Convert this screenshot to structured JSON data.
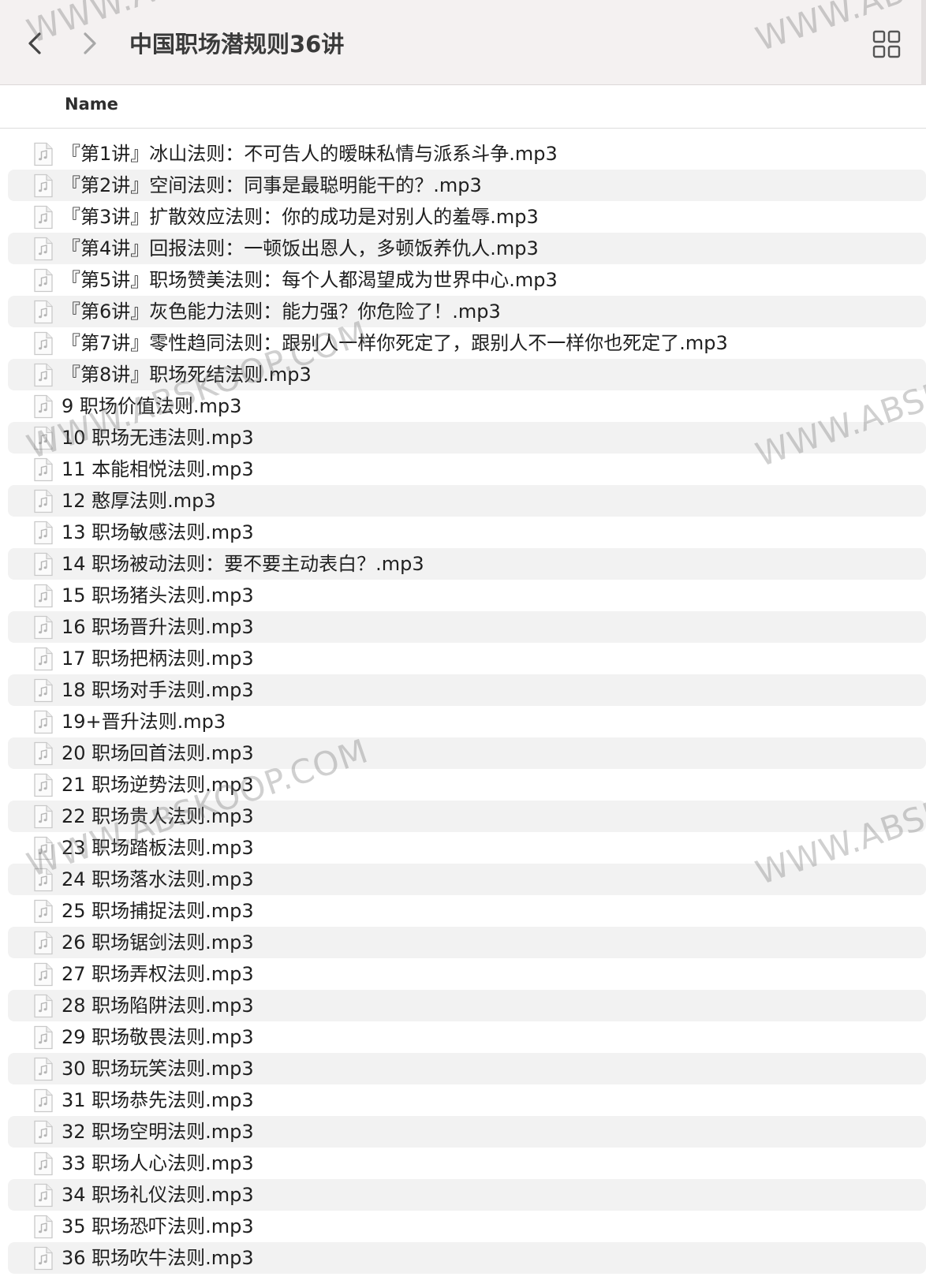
{
  "toolbar": {
    "title": "中国职场潜规则36讲",
    "back_icon": "chevron-left-icon",
    "forward_icon": "chevron-right-icon",
    "view_icon": "grid-view-icon"
  },
  "list_header": {
    "name_label": "Name"
  },
  "files": [
    "『第1讲』冰山法则：不可告人的暧昧私情与派系斗争.mp3",
    "『第2讲』空间法则：同事是最聪明能干的？.mp3",
    "『第3讲』扩散效应法则：你的成功是对别人的羞辱.mp3",
    "『第4讲』回报法则：一顿饭出恩人，多顿饭养仇人.mp3",
    "『第5讲』职场赞美法则：每个人都渴望成为世界中心.mp3",
    "『第6讲』灰色能力法则：能力强？你危险了！.mp3",
    "『第7讲』零性趋同法则：跟别人一样你死定了，跟别人不一样你也死定了.mp3",
    "『第8讲』职场死结法则.mp3",
    "9 职场价值法则.mp3",
    "10 职场无违法则.mp3",
    "11 本能相悦法则.mp3",
    "12 憨厚法则.mp3",
    "13 职场敏感法则.mp3",
    "14 职场被动法则：要不要主动表白？.mp3",
    "15 职场猪头法则.mp3",
    "16 职场晋升法则.mp3",
    "17 职场把柄法则.mp3",
    "18 职场对手法则.mp3",
    "19+晋升法则.mp3",
    "20 职场回首法则.mp3",
    "21 职场逆势法则.mp3",
    "22 职场贵人法则.mp3",
    "23 职场踏板法则.mp3",
    "24 职场落水法则.mp3",
    "25 职场捕捉法则.mp3",
    "26 职场锯剑法则.mp3",
    "27 职场弄权法则.mp3",
    "28 职场陷阱法则.mp3",
    "29 职场敬畏法则.mp3",
    "30 职场玩笑法则.mp3",
    "31 职场恭先法则.mp3",
    "32 职场空明法则.mp3",
    "33 职场人心法则.mp3",
    "34 职场礼仪法则.mp3",
    "35 职场恐吓法则.mp3",
    "36 职场吹牛法则.mp3"
  ],
  "file_icon": "audio-file-icon",
  "watermark_text": "WWW.ABSKOOP.COM",
  "colors": {
    "toolbar_bg": "#f4f1f1",
    "row_alt_bg": "#f2f2f2",
    "text": "#1f1f1f"
  }
}
